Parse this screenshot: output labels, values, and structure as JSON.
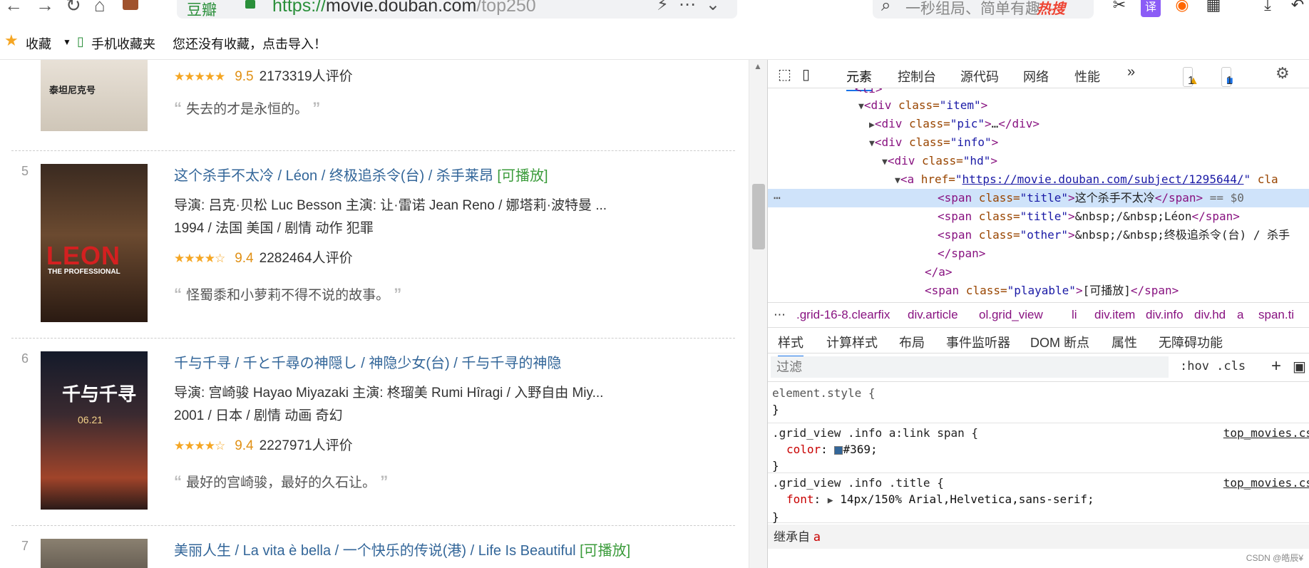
{
  "browser": {
    "site_label": "豆瓣",
    "url_scheme": "https://",
    "url_host": "movie.douban.com",
    "url_path": "/top250",
    "search_placeholder": "一秒组局、简单有趣",
    "search_hot": "热搜"
  },
  "bookmarks": {
    "favorites": "收藏",
    "mobile": "手机收藏夹",
    "hint": "您还没有收藏，点击导入！"
  },
  "page": {
    "prev_item": {
      "score": "9.5",
      "count": "2173319人评价",
      "quote": "失去的才是永恒的。"
    },
    "items": [
      {
        "rank": "5",
        "title": "这个杀手不太冷",
        "title2": " / Léon ",
        "other": " / 终极追杀令(台) / 杀手莱昂",
        "playable": "[可播放]",
        "director": "导演: 吕克·贝松 Luc Besson   主演: 让·雷诺 Jean Reno / 娜塔莉·波特曼 ...",
        "meta": "1994 / 法国 美国 / 剧情 动作 犯罪",
        "score": "9.4",
        "count": "2282464人评价",
        "quote": "怪蜀黍和小萝莉不得不说的故事。",
        "rating": 4.5
      },
      {
        "rank": "6",
        "title": "千与千寻",
        "title2": " / 千と千尋の神隠し ",
        "other": " / 神隐少女(台) / 千与千寻的神隐",
        "playable": "",
        "director": "导演: 宫崎骏 Hayao Miyazaki   主演: 柊瑠美 Rumi Hîragi / 入野自由 Miy...",
        "meta": "2001 / 日本 / 剧情 动画 奇幻",
        "score": "9.4",
        "count": "2227971人评价",
        "quote": "最好的宫崎骏，最好的久石让。",
        "rating": 4.5
      },
      {
        "rank": "7",
        "title": "美丽人生",
        "title2": " / La vita è bella ",
        "other": " / 一个快乐的传说(港) / Life Is Beautiful",
        "playable": "[可播放]"
      }
    ]
  },
  "devtools": {
    "tabs": [
      "元素",
      "控制台",
      "源代码",
      "网络",
      "性能"
    ],
    "warn_count": "1",
    "msg_count": "1",
    "dom": {
      "l1_tag": "<div",
      "l1_attr": " class=",
      "l1_val": "\"item\"",
      "l2": "\"pic\"",
      "l3": "\"info\"",
      "l4": "\"hd\"",
      "href": "https://movie.douban.com/subject/1295644/",
      "sel_text": "这个杀手不太冷",
      "sel_eq": " == $0",
      "t2_text": "&nbsp;/&nbsp;Léon",
      "other_text": "&nbsp;/&nbsp;终极追杀令(台) / 杀手",
      "playable_text": "[可播放]"
    },
    "crumbs": [
      ".grid-16-8.clearfix",
      "div.article",
      "ol.grid_view",
      "li",
      "div.item",
      "div.info",
      "div.hd",
      "a",
      "span.ti"
    ],
    "style_tabs": [
      "样式",
      "计算样式",
      "布局",
      "事件监听器",
      "DOM 断点",
      "属性",
      "无障碍功能"
    ],
    "filter_placeholder": "过滤",
    "filter_opts": ":hov  .cls",
    "rules": {
      "r1_sel": "element.style {",
      "r2_sel": ".grid_view .info a:link span {",
      "r2_src": "top_movies.cs",
      "r2_prop": "color",
      "r2_val": "#369;",
      "r2_color": "#336699",
      "r3_sel": ".grid_view .info .title {",
      "r3_src": "top_movies.cs",
      "r3_prop": "font",
      "r3_val": "14px/150% Arial,Helvetica,sans-serif;",
      "close": "}"
    },
    "inherit_label": "继承自",
    "inherit_tag": "a"
  },
  "watermark": "CSDN @皓辰¥"
}
